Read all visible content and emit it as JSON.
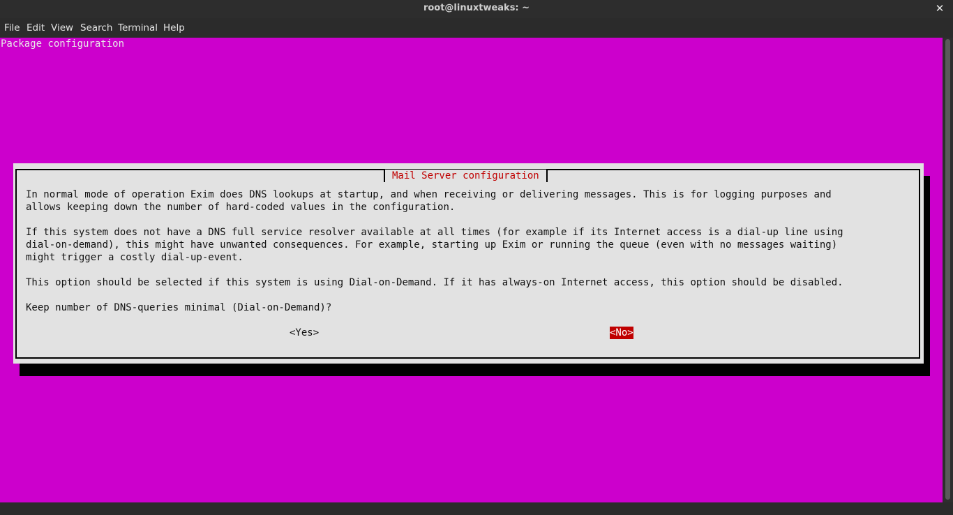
{
  "window": {
    "title": "root@linuxtweaks: ~",
    "close_glyph": "✕"
  },
  "menu": {
    "items": [
      "File",
      "Edit",
      "View",
      "Search",
      "Terminal",
      "Help"
    ]
  },
  "terminal": {
    "header": "Package configuration",
    "background_color": "#cc00cc"
  },
  "dialog": {
    "title": "Mail Server configuration",
    "paragraphs": [
      "In normal mode of operation Exim does DNS lookups at startup, and when receiving or delivering messages. This is for logging purposes and\nallows keeping down the number of hard-coded values in the configuration.",
      "If this system does not have a DNS full service resolver available at all times (for example if its Internet access is a dial-up line using\ndial-on-demand), this might have unwanted consequences. For example, starting up Exim or running the queue (even with no messages waiting)\nmight trigger a costly dial-up-event.",
      "This option should be selected if this system is using Dial-on-Demand. If it has always-on Internet access, this option should be disabled.",
      "Keep number of DNS-queries minimal (Dial-on-Demand)?"
    ],
    "yes_label": "<Yes>",
    "no_label": "<No>",
    "selected": "No",
    "accent_color": "#c00000"
  }
}
